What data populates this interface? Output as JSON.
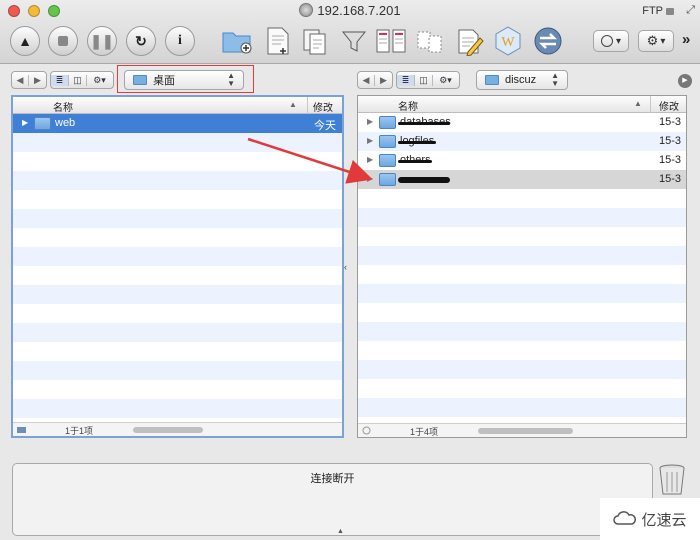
{
  "window": {
    "title": "192.168.7.201",
    "protocol_badge": "FTP"
  },
  "toolbar": {
    "round_buttons": [
      "up-arrow-icon",
      "stop-icon",
      "pause-icon",
      "refresh-icon",
      "info-icon"
    ],
    "action_icons": [
      "new-folder-icon",
      "new-file-icon",
      "duplicate-icon",
      "filter-icon",
      "compare-icon",
      "sync-icon",
      "edit-icon",
      "web-icon",
      "connect-icon"
    ],
    "history_icon": "clock-icon",
    "settings_icon": "gear-icon",
    "overflow": "»"
  },
  "left_pane": {
    "location": "桌面",
    "columns": {
      "name": "名称",
      "modified": "修改日"
    },
    "rows": [
      {
        "name": "web",
        "modified": "今天",
        "selected": true
      }
    ],
    "status": "1于1项"
  },
  "right_pane": {
    "location": "discuz",
    "columns": {
      "name": "名称",
      "modified": "修改日"
    },
    "rows": [
      {
        "name": "databases",
        "modified": "15-3"
      },
      {
        "name": "logfiles",
        "modified": "15-3"
      },
      {
        "name": "others",
        "modified": "15-3"
      },
      {
        "name": "",
        "modified": "15-3",
        "highlighted": true
      }
    ],
    "status": "1于4项"
  },
  "log": {
    "text": "连接断开"
  },
  "watermark": {
    "text": "亿速云"
  },
  "colors": {
    "selection": "#3f7fd6",
    "annotation_red": "#e23a3a",
    "folder_blue": "#6ea7e0"
  }
}
